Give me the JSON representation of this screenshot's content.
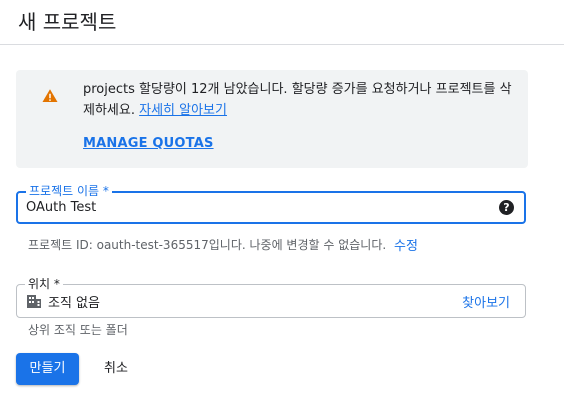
{
  "header": {
    "title": "새 프로젝트"
  },
  "notice": {
    "icon": "warning-icon",
    "icon_color": "#e37400",
    "message": "projects 할당량이 12개 남았습니다. 할당량 증가를 요청하거나 프로젝트를 삭제하세요.",
    "learn_more": "자세히 알아보기",
    "manage_quotas": "MANAGE QUOTAS"
  },
  "project_name": {
    "label": "프로젝트 이름 *",
    "value": "OAuth Test",
    "help_icon": "help-icon"
  },
  "project_id": {
    "text": "프로젝트 ID: oauth-test-365517입니다. 나중에 변경할 수 없습니다.",
    "edit_label": "수정"
  },
  "location": {
    "label": "위치 *",
    "icon": "building-icon",
    "value": "조직 없음",
    "browse_label": "찾아보기",
    "helper": "상위 조직 또는 폴더"
  },
  "actions": {
    "create_label": "만들기",
    "cancel_label": "취소"
  },
  "colors": {
    "accent": "#1a73e8",
    "notice_bg": "#f1f3f4"
  }
}
